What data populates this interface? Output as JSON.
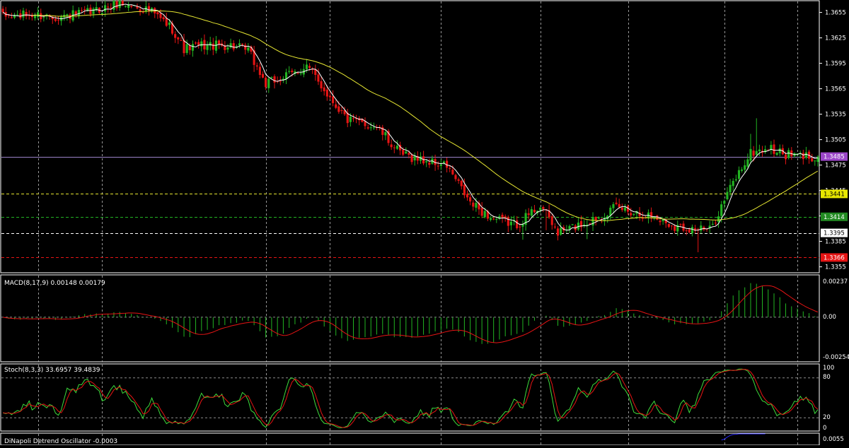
{
  "colors": {
    "background": "#000000",
    "frame": "#ffffff",
    "grid": "#c8c8c8",
    "axis_text": "#ffffff",
    "bull_candle": "#22b422",
    "bear_candle": "#e61414",
    "fast_ma": "#ffffff",
    "slow_ma": "#e6e632",
    "macd_hist": "#22b422",
    "macd_signal": "#e61414",
    "stoch_main": "#3cdc3c",
    "stoch_signal": "#e61414",
    "dinapoli": "#2828ff",
    "hline_yellow": "#e6e632",
    "hline_green": "#22b422",
    "hline_white": "#ffffff",
    "hline_red": "#e61414",
    "bid_line": "#9b82c8",
    "tag_bid_bg": "#9b46c8",
    "tag_yellow_bg": "#e6e600",
    "tag_green_bg": "#228b22",
    "tag_white_bg": "#ffffff",
    "tag_red_bg": "#e61414"
  },
  "price_panel": {
    "axis_labels": [
      "1.3655",
      "1.3625",
      "1.3595",
      "1.3565",
      "1.3535",
      "1.3505",
      "1.3475",
      "1.3445",
      "1.3415",
      "1.3385",
      "1.3355"
    ],
    "price_tags": [
      {
        "price": 1.3485,
        "label": "1.3485",
        "style": "bid"
      },
      {
        "price": 1.3441,
        "label": "1.3441",
        "style": "yellow"
      },
      {
        "price": 1.3414,
        "label": "1.3414",
        "style": "green"
      },
      {
        "price": 1.3395,
        "label": "1.3395",
        "style": "white"
      },
      {
        "price": 1.3366,
        "label": "1.3366",
        "style": "red"
      }
    ],
    "fast_ma_icon": "white-line",
    "slow_ma_icon": "yellow-line"
  },
  "macd_panel": {
    "title": "MACD(8,17,9) 0.00148 0.00179",
    "axis_labels": {
      "top": "0.00237",
      "zero": "0.00",
      "bottom": "-0.00254"
    }
  },
  "stoch_panel": {
    "title": "Stoch(8,3,3) 33.6957 39.4839",
    "axis_labels": {
      "l100": "100",
      "l80": "80",
      "l20": "20",
      "l0": "0"
    }
  },
  "dinapoli_panel": {
    "title": "DiNapoli Detrend Oscillator -0.0003",
    "axis_labels": {
      "top": "0.0055"
    }
  },
  "chart_data": [
    {
      "type": "candlestick",
      "name": "price",
      "yrange": [
        1.3348,
        1.3668
      ],
      "anchors": [
        [
          0,
          1.365
        ],
        [
          10,
          1.3652
        ],
        [
          20,
          1.365
        ],
        [
          30,
          1.3655
        ],
        [
          40,
          1.3666
        ],
        [
          50,
          1.3658
        ],
        [
          58,
          1.3636
        ],
        [
          62,
          1.3612
        ],
        [
          68,
          1.3616
        ],
        [
          78,
          1.3616
        ],
        [
          84,
          1.361
        ],
        [
          90,
          1.357
        ],
        [
          100,
          1.3584
        ],
        [
          104,
          1.3592
        ],
        [
          112,
          1.3555
        ],
        [
          118,
          1.3528
        ],
        [
          128,
          1.352
        ],
        [
          136,
          1.3488
        ],
        [
          148,
          1.3477
        ],
        [
          152,
          1.3474
        ],
        [
          160,
          1.343
        ],
        [
          168,
          1.3411
        ],
        [
          176,
          1.3405
        ],
        [
          184,
          1.3428
        ],
        [
          190,
          1.3395
        ],
        [
          200,
          1.3408
        ],
        [
          210,
          1.3425
        ],
        [
          222,
          1.3415
        ],
        [
          230,
          1.3403
        ],
        [
          242,
          1.3398
        ],
        [
          250,
          1.3455
        ],
        [
          256,
          1.3489
        ],
        [
          262,
          1.3495
        ],
        [
          268,
          1.3487
        ],
        [
          272,
          1.3486
        ],
        [
          279,
          1.3485
        ]
      ],
      "candle_count": 280,
      "fast_ma_period": 5,
      "slow_ma_period": 40
    },
    {
      "type": "macd",
      "series": [
        "histogram",
        "signal"
      ],
      "yrange": [
        -0.00254,
        0.00237
      ],
      "last_values": {
        "macd": 0.00148,
        "signal": 0.00179
      }
    },
    {
      "type": "stochastic",
      "series": [
        "%K",
        "%D"
      ],
      "yrange": [
        0,
        100
      ],
      "levels": [
        20,
        80
      ],
      "last_values": {
        "k": 33.6957,
        "d": 39.4839
      }
    },
    {
      "type": "oscillator",
      "name": "DiNapoli Detrend Oscillator",
      "last_value": -0.0003
    }
  ]
}
